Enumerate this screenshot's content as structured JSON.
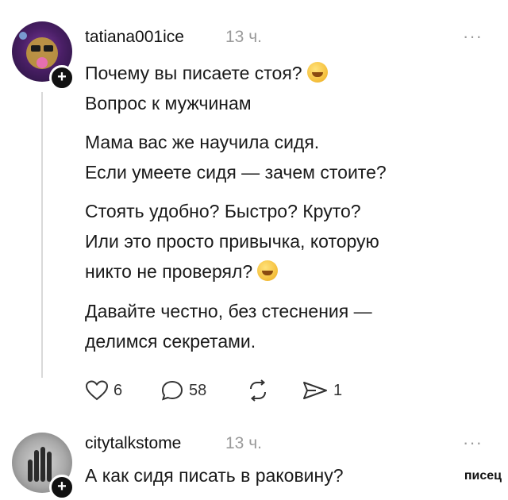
{
  "post1": {
    "username": "tatiana001ice",
    "time": "13 ч.",
    "more": "···",
    "follow": "+",
    "paragraphs": [
      [
        "Почему вы писаете стоя?",
        "Вопрос к мужчинам"
      ],
      [
        "Мама вас же научила сидя.",
        "Если умеете сидя — зачем стоите?"
      ],
      [
        "Стоять удобно? Быстро? Круто?",
        "Или это просто привычка, которую",
        "никто не проверял?"
      ],
      [
        "Давайте честно, без стеснения —",
        "делимся секретами."
      ]
    ],
    "actions": {
      "likes": "6",
      "comments": "58",
      "reposts": "",
      "shares": "1"
    }
  },
  "post2": {
    "username": "citytalkstome",
    "time": "13 ч.",
    "more": "···",
    "follow": "+",
    "text": "А как сидя писать в раковину?"
  },
  "watermark": "писец",
  "icons": [
    "heart-icon",
    "comment-icon",
    "repost-icon",
    "share-icon",
    "thinking-emoji-icon",
    "grinning-emoji-icon",
    "more-icon",
    "plus-icon"
  ]
}
